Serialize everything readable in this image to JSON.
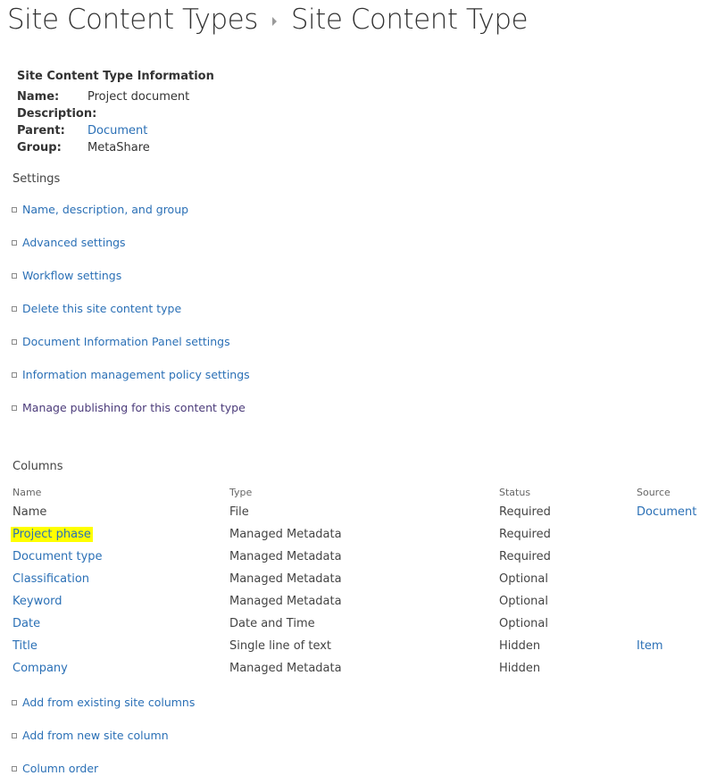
{
  "breadcrumb": {
    "parent": "Site Content Types",
    "current": "Site Content Type"
  },
  "info": {
    "title": "Site Content Type Information",
    "name_label": "Name:",
    "name_value": "Project document",
    "description_label": "Description:",
    "description_value": "",
    "parent_label": "Parent:",
    "parent_value": "Document",
    "group_label": "Group:",
    "group_value": "MetaShare"
  },
  "settings": {
    "title": "Settings",
    "links": [
      "Name, description, and group",
      "Advanced settings",
      "Workflow settings",
      "Delete this site content type",
      "Document Information Panel settings",
      "Information management policy settings",
      "Manage publishing for this content type"
    ]
  },
  "columns": {
    "title": "Columns",
    "headers": [
      "Name",
      "Type",
      "Status",
      "Source"
    ],
    "rows": [
      {
        "name": "Name",
        "type": "File",
        "status": "Required",
        "source": "Document"
      },
      {
        "name": "Project phase",
        "type": "Managed Metadata",
        "status": "Required",
        "source": ""
      },
      {
        "name": "Document type",
        "type": "Managed Metadata",
        "status": "Required",
        "source": ""
      },
      {
        "name": "Classification",
        "type": "Managed Metadata",
        "status": "Optional",
        "source": ""
      },
      {
        "name": "Keyword",
        "type": "Managed Metadata",
        "status": "Optional",
        "source": ""
      },
      {
        "name": "Date",
        "type": "Date and Time",
        "status": "Optional",
        "source": ""
      },
      {
        "name": "Title",
        "type": "Single line of text",
        "status": "Hidden",
        "source": "Item"
      },
      {
        "name": "Company",
        "type": "Managed Metadata",
        "status": "Hidden",
        "source": ""
      }
    ],
    "highlight_color": "#ffff00",
    "links": [
      "Add from existing site columns",
      "Add from new site column",
      "Column order"
    ]
  },
  "colors": {
    "link": "#2b70b6",
    "visited_link": "#4b3b7a",
    "text": "#444444"
  }
}
